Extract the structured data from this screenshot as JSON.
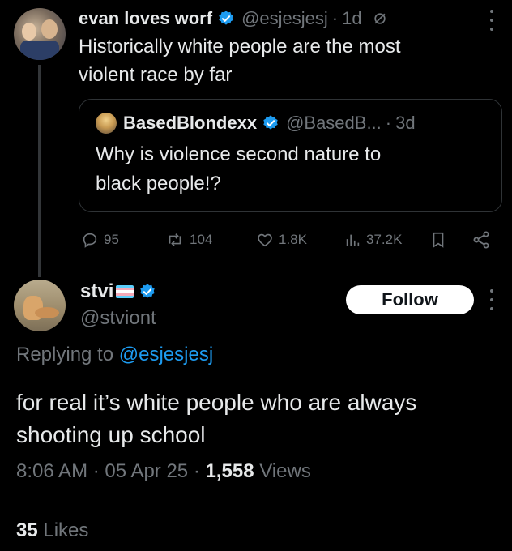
{
  "parent_tweet": {
    "display_name": "evan loves worf",
    "handle": "@esjesjesj",
    "time": "1d",
    "separator": "·",
    "text_line1": "Historically white people are the most",
    "text_line2": "violent race by far",
    "quoted": {
      "display_name": "BasedBlondexx",
      "handle": "@BasedB...",
      "separator": "·",
      "time": "3d",
      "text_line1": "Why is violence second nature to",
      "text_line2": "black people!?"
    },
    "actions": {
      "replies": "95",
      "reposts": "104",
      "likes": "1.8K",
      "views": "37.2K"
    }
  },
  "main_tweet": {
    "display_name": "stvi",
    "handle": "@stviont",
    "follow_label": "Follow",
    "replying_prefix": "Replying to",
    "replying_handle": "@esjesjesj",
    "text_line1": "for real it’s white people who are always",
    "text_line2": "shooting up school",
    "time": "8:06 AM",
    "date": "05 Apr 25",
    "separator": "·",
    "views_count": "1,558",
    "views_label": "Views",
    "likes_count": "35",
    "likes_label": "Likes"
  },
  "colors": {
    "background": "#000000",
    "text": "#e7e9ea",
    "muted": "#71767b",
    "accent": "#1d9bf0"
  }
}
